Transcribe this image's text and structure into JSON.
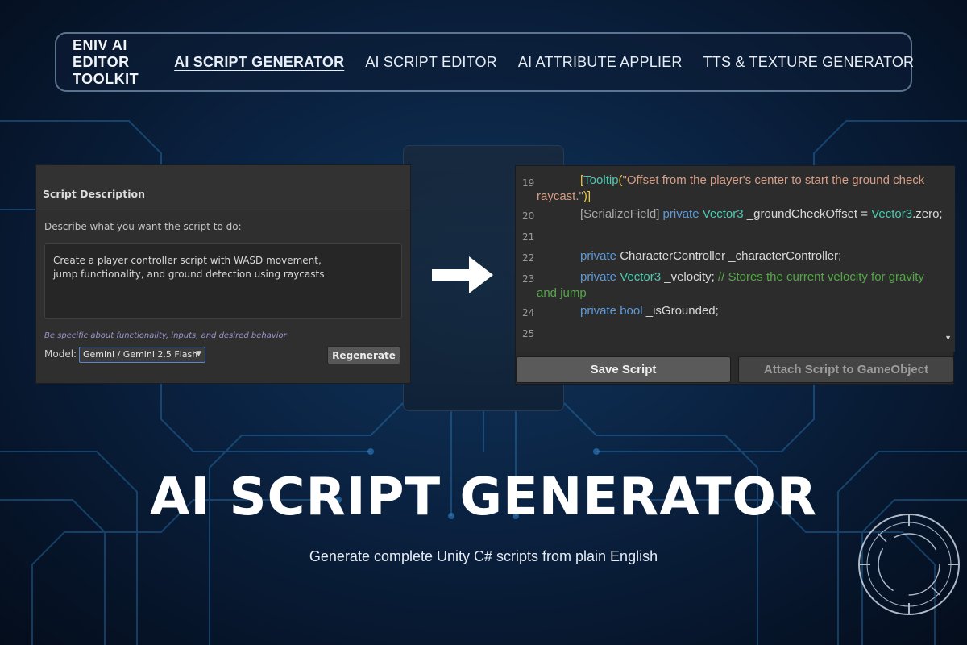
{
  "nav": {
    "brand": "ENIV AI EDITOR TOOLKIT",
    "links": [
      {
        "label": "AI SCRIPT GENERATOR",
        "active": true
      },
      {
        "label": "AI SCRIPT EDITOR",
        "active": false
      },
      {
        "label": "AI ATTRIBUTE APPLIER",
        "active": false
      },
      {
        "label": "TTS & TEXTURE GENERATOR",
        "active": false
      }
    ]
  },
  "left_panel": {
    "title": "Script Description",
    "instruction": "Describe what you want the script to do:",
    "description_value": "Create a player controller script with WASD movement,\njump functionality, and ground detection using raycasts",
    "hint": "Be specific about functionality, inputs, and desired behavior",
    "model_label": "Model:",
    "model_selected": "Gemini / Gemini 2.5 Flash",
    "regenerate_label": "Regenerate"
  },
  "code": {
    "line_numbers": [
      "19",
      "20",
      "21",
      "22",
      "23",
      "24",
      "25"
    ],
    "l19_open": "[",
    "l19_attr": "Tooltip",
    "l19_paren": "(",
    "l19_str1": "\"Offset from the player's center to start the ground check",
    "l19_str2": "raycast.\"",
    "l19_close": ")]",
    "l20_attr": "[SerializeField]",
    "l20_kw": "private",
    "l20_type": "Vector3",
    "l20_mid": "_groundCheckOffset =",
    "l20_type2": "Vector3",
    "l20_end": ".zero;",
    "l22_kw": "private",
    "l22_rest": "CharacterController _characterController;",
    "l23_kw": "private",
    "l23_type": "Vector3",
    "l23_rest": "_velocity;",
    "l23_comment1": "// Stores the current velocity for gravity",
    "l23_comment2": "and jump",
    "l24_kw": "private bool",
    "l24_rest": "_isGrounded;"
  },
  "right_panel": {
    "save_label": "Save Script",
    "attach_label": "Attach Script to GameObject"
  },
  "hero": {
    "title": "AI SCRIPT GENERATOR",
    "subtitle": "Generate complete Unity C# scripts from plain English"
  },
  "colors": {
    "background": "#0b2444",
    "accent_circuit": "#2f8fd8",
    "panel_bg": "#2f2f2f",
    "code_keyword": "#5f9ad6",
    "code_type": "#4ec9b0",
    "code_string": "#d69d85",
    "code_comment": "#57a64a"
  },
  "icons": [
    "right-arrow-icon",
    "dropdown-caret-icon",
    "scroll-caret-icon",
    "circular-hud-icon"
  ]
}
